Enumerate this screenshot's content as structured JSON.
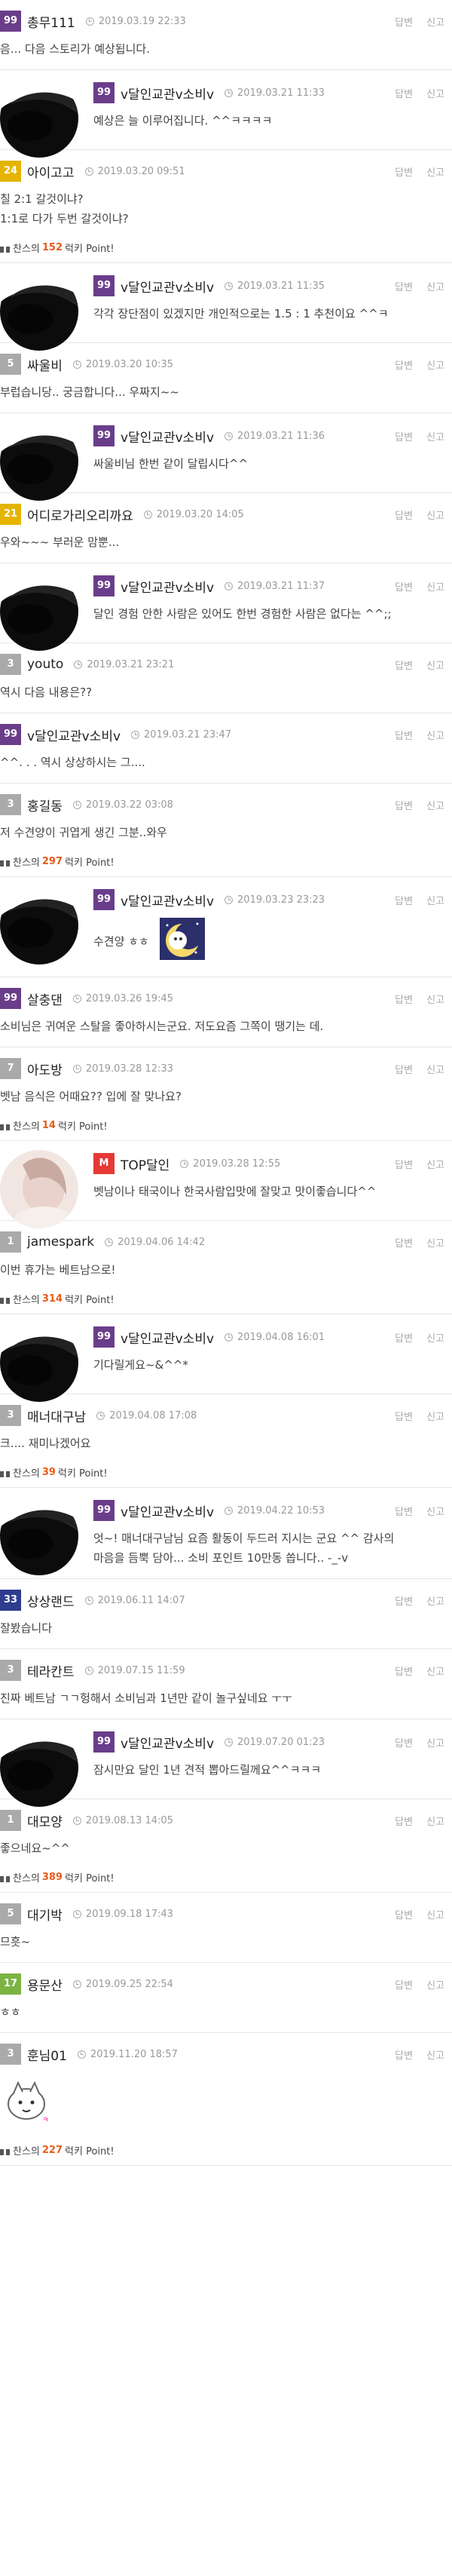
{
  "actions": {
    "reply": "답변",
    "report": "신고"
  },
  "point_prefix": "찬스의",
  "point_suffix": "럭키 Point!",
  "level_colors": {
    "purple": "#6a3d8a",
    "gray": "#aaaaaa",
    "yellow": "#e5b400",
    "green": "#7cb342",
    "navy": "#2f3d8f",
    "red": "#e53935"
  },
  "comments": [
    {
      "type": "top",
      "level": "99",
      "level_color": "purple",
      "author": "총무111",
      "date": "2019.03.19 22:33",
      "text": "음... 다음 스토리가 예상됩니다."
    },
    {
      "type": "reply",
      "level": "99",
      "level_color": "purple",
      "author": "v달인교관v소비v",
      "date": "2019.03.21 11:33",
      "text": "예상은 늘 이루어집니다. ^^ㅋㅋㅋㅋ"
    },
    {
      "type": "top",
      "level": "24",
      "level_color": "yellow",
      "author": "아이고고",
      "date": "2019.03.20 09:51",
      "lines": [
        "칠 2:1 갈것이냐?",
        "1:1로 다가 두번 갈것이냐?"
      ],
      "point": "152"
    },
    {
      "type": "reply",
      "level": "99",
      "level_color": "purple",
      "author": "v달인교관v소비v",
      "date": "2019.03.21 11:35",
      "text": "각각 장단점이 있겠지만 개인적으로는 1.5 : 1 추천이요 ^^ㅋ"
    },
    {
      "type": "top",
      "level": "5",
      "level_color": "gray",
      "author": "싸울비",
      "date": "2019.03.20 10:35",
      "text": "부럽습니당.. 궁금합니다... 우짜지~~"
    },
    {
      "type": "reply",
      "level": "99",
      "level_color": "purple",
      "author": "v달인교관v소비v",
      "date": "2019.03.21 11:36",
      "text": "싸울비님 한번 같이 달립시다^^"
    },
    {
      "type": "top",
      "level": "21",
      "level_color": "yellow",
      "author": "어디로가리오리까요",
      "date": "2019.03.20 14:05",
      "text": "우와~~~ 부러운 맘뿐..."
    },
    {
      "type": "reply",
      "level": "99",
      "level_color": "purple",
      "author": "v달인교관v소비v",
      "date": "2019.03.21 11:37",
      "text": "달인 경험 안한 사람은 있어도 한번 경험한 사람은 없다는 ^^;;"
    },
    {
      "type": "top",
      "level": "3",
      "level_color": "gray",
      "author": "youto",
      "date": "2019.03.21 23:21",
      "text": "역시 다음 내용은??"
    },
    {
      "type": "top",
      "level": "99",
      "level_color": "purple",
      "author": "v달인교관v소비v",
      "date": "2019.03.21 23:47",
      "text": "^^. . . 역시 상상하시는 그...."
    },
    {
      "type": "top",
      "level": "3",
      "level_color": "gray",
      "author": "홍길동",
      "date": "2019.03.22 03:08",
      "text": "저 수견양이 귀엽게 생긴 그분..와우",
      "point": "297"
    },
    {
      "type": "reply",
      "level": "99",
      "level_color": "purple",
      "author": "v달인교관v소비v",
      "date": "2019.03.23 23:23",
      "text": "수견양 ㅎㅎ",
      "emoticon": true
    },
    {
      "type": "top",
      "level": "99",
      "level_color": "purple",
      "author": "살충댄",
      "date": "2019.03.26 19:45",
      "text": "소비님은  귀여운 스탈을 좋아하시는군요. 저도요즘 그쪽이 땡기는  데."
    },
    {
      "type": "top",
      "level": "7",
      "level_color": "gray",
      "author": "아도방",
      "date": "2019.03.28 12:33",
      "text": "벳남 음식은 어때요?? 입에 잘 맞나요?",
      "point": "14"
    },
    {
      "type": "reply",
      "level": "M",
      "level_color": "red",
      "author": "TOP달인",
      "date": "2019.03.28 12:55",
      "text": "벳남이나 태국이나 한국사람입맛에 잘맞고 맛이좋습니다^^",
      "photo": true
    },
    {
      "type": "top",
      "level": "1",
      "level_color": "gray",
      "author": "jamespark",
      "date": "2019.04.06 14:42",
      "text": "이번 휴가는 베트남으로!",
      "point": "314"
    },
    {
      "type": "reply",
      "level": "99",
      "level_color": "purple",
      "author": "v달인교관v소비v",
      "date": "2019.04.08 16:01",
      "text": "기다릴게요~&^^*"
    },
    {
      "type": "top",
      "level": "3",
      "level_color": "gray",
      "author": "매너대구남",
      "date": "2019.04.08 17:08",
      "text": "크.... 재미나겠어요",
      "point": "39"
    },
    {
      "type": "reply",
      "level": "99",
      "level_color": "purple",
      "author": "v달인교관v소비v",
      "date": "2019.04.22 10:53",
      "lines": [
        "엇~! 매너대구남님 요즘 활동이 두드러 지시는 군요 ^^ 감사의",
        "마음을 듬뿍 담아... 소비 포인트 10만동 쏩니다.. -_-v"
      ]
    },
    {
      "type": "top",
      "level": "33",
      "level_color": "navy",
      "author": "상상랜드",
      "date": "2019.06.11 14:07",
      "text": "잘봤습니다"
    },
    {
      "type": "top",
      "level": "3",
      "level_color": "gray",
      "author": "테라칸트",
      "date": "2019.07.15 11:59",
      "text": "진짜 베트남 ㄱㄱ헝해서 소비님과 1년만 같이 놀구싶네요 ㅜㅜ"
    },
    {
      "type": "reply",
      "level": "99",
      "level_color": "purple",
      "author": "v달인교관v소비v",
      "date": "2019.07.20 01:23",
      "text": "잠시만요 달인 1년 견적 뽑아드릴께요^^ㅋㅋㅋ"
    },
    {
      "type": "top",
      "level": "1",
      "level_color": "gray",
      "author": "대모양",
      "date": "2019.08.13 14:05",
      "text": "좋으네요~^^",
      "point": "389"
    },
    {
      "type": "top",
      "level": "5",
      "level_color": "gray",
      "author": "대기박",
      "date": "2019.09.18 17:43",
      "text": "므흣~"
    },
    {
      "type": "top",
      "level": "17",
      "level_color": "green",
      "author": "용문산",
      "date": "2019.09.25 22:54",
      "text": "ㅎㅎ"
    },
    {
      "type": "top",
      "level": "3",
      "level_color": "gray",
      "author": "훈님01",
      "date": "2019.11.20 18:57",
      "image": true,
      "point": "227"
    }
  ]
}
